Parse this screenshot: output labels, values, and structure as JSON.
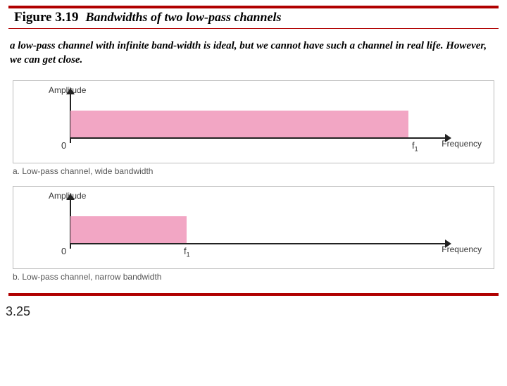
{
  "figure": {
    "number": "Figure 3.19",
    "title": "Bandwidths of two low-pass channels"
  },
  "description": "a low-pass channel with infinite band-width is ideal, but we cannot have such a channel in real life. However, we can get close.",
  "labels": {
    "amplitude": "Amplitude",
    "frequency": "Frequency",
    "zero": "0",
    "f1": "f",
    "f1_sub": "1"
  },
  "charts": {
    "a": {
      "caption": "a. Low-pass channel, wide bandwidth"
    },
    "b": {
      "caption": "b. Low-pass channel, narrow bandwidth"
    }
  },
  "chart_data": [
    {
      "type": "area",
      "name": "wide bandwidth low-pass",
      "xlabel": "Frequency",
      "ylabel": "Amplitude",
      "x_range_label_start": "0",
      "x_range_label_end": "f1",
      "band_relative_width": 0.82,
      "title": "Low-pass channel, wide bandwidth"
    },
    {
      "type": "area",
      "name": "narrow bandwidth low-pass",
      "xlabel": "Frequency",
      "ylabel": "Amplitude",
      "x_range_label_start": "0",
      "x_range_label_end": "f1",
      "band_relative_width": 0.3,
      "title": "Low-pass channel, narrow bandwidth"
    }
  ],
  "page_number": "3.25",
  "colors": {
    "accent": "#b00000",
    "band": "#f2a6c4"
  }
}
